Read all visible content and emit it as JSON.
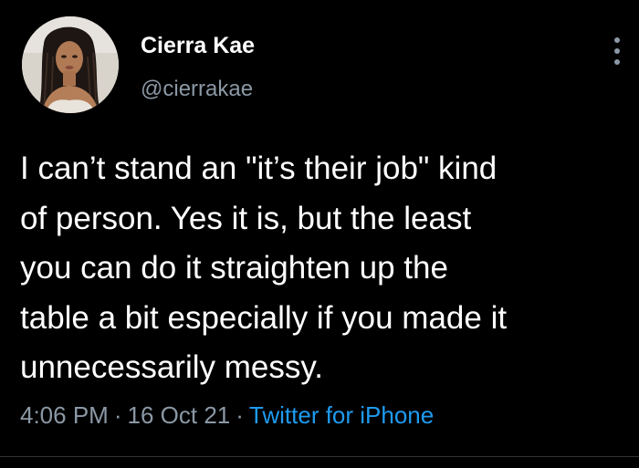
{
  "author": {
    "display_name": "Cierra Kae",
    "handle": "@cierrakae"
  },
  "tweet": {
    "text": "I can’t stand an \"it’s their job\" kind\nof person. Yes it is, but the least\nyou can do it straighten up the\ntable a bit especially if you made it\nunnecessarily messy.",
    "time": "4:06 PM",
    "date": "16 Oct 21",
    "separator": "·",
    "source": "Twitter for iPhone"
  },
  "icons": {
    "more": "more-vertical-icon"
  },
  "colors": {
    "background": "#000000",
    "text": "#ffffff",
    "secondary_text": "#8b98a5",
    "link": "#1d9bf0",
    "divider": "#2f3336"
  }
}
